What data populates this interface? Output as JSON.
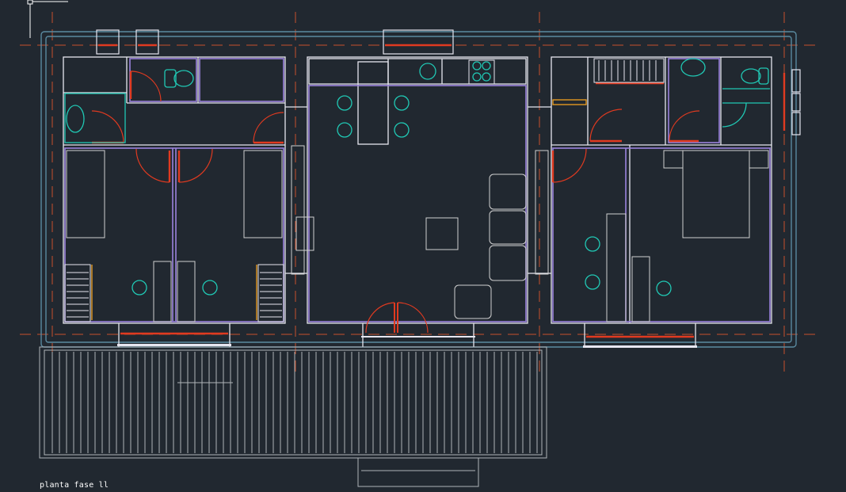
{
  "drawing": {
    "label": "planta fase ll"
  },
  "colors": {
    "background": "#212830",
    "axis": "#c8502c",
    "outer_wall": "#5a8aa0",
    "wall": "#e6e6f0",
    "partition": "#9a82dc",
    "door": "#e03a20",
    "fixture": "#20c8b4",
    "furniture": "#d0d0d0",
    "cabinet": "#f0a020",
    "deck": "#aeb4b8"
  },
  "viewport": {
    "cursor": "crosshair-cursor"
  }
}
